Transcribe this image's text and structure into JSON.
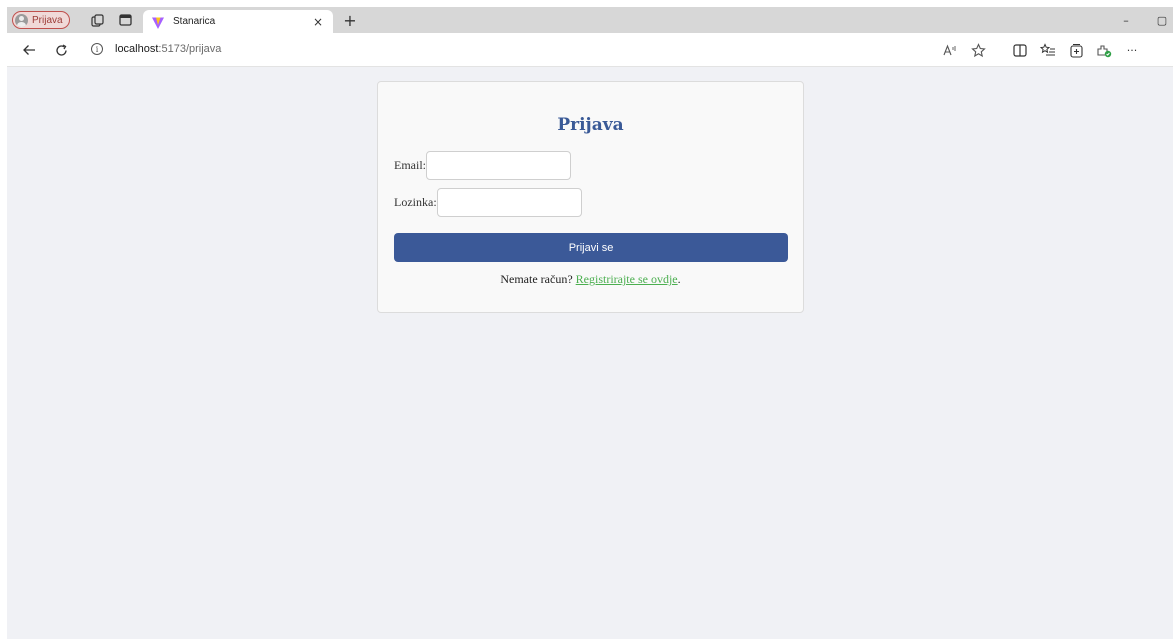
{
  "browser": {
    "profile_label": "Prijava",
    "tab_title": "Stanarica",
    "tab_close": "×",
    "new_tab": "+",
    "minimize": "–",
    "restore": "▢",
    "url_host": "localhost",
    "url_path": ":5173/prijava",
    "more_tools": "···"
  },
  "login": {
    "title": "Prijava",
    "email_label": "Email:",
    "email_value": "",
    "password_label": "Lozinka:",
    "password_value": "",
    "submit_label": "Prijavi se",
    "register_prompt": "Nemate račun? ",
    "register_link": "Registrirajte se ovdje",
    "register_suffix": "."
  },
  "colors": {
    "accent": "#3b5998",
    "title": "#3a5a97",
    "link": "#4caf50",
    "page_bg": "#f0f1f5"
  },
  "icons": {
    "profile": "person-icon",
    "workspaces": "workspaces-icon",
    "tab_actions": "tab-actions-icon",
    "favicon": "vite-logo-icon",
    "back": "back-arrow-icon",
    "refresh": "refresh-icon",
    "site_info": "info-icon",
    "read_aloud": "read-aloud-icon",
    "favorite": "star-icon",
    "split_screen": "split-screen-icon",
    "favorites": "favorites-list-icon",
    "collections": "collections-icon",
    "extensions": "extension-icon",
    "more": "more-icon"
  }
}
